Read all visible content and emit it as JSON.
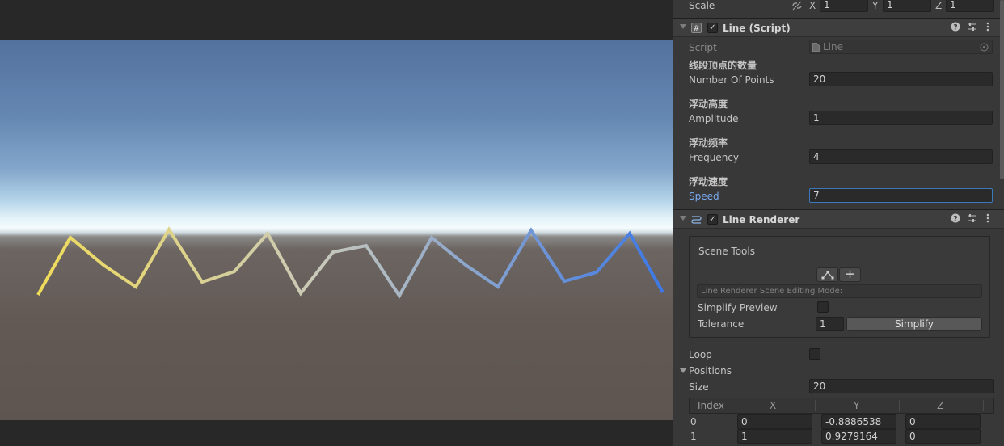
{
  "scale": {
    "label": "Scale",
    "x": "1",
    "y": "1",
    "z": "1"
  },
  "line_script": {
    "title": "Line (Script)",
    "script_label": "Script",
    "script_value": "Line",
    "num_points_header": "线段顶点的数量",
    "num_points_label": "Number Of Points",
    "num_points_value": "20",
    "amplitude_header": "浮动高度",
    "amplitude_label": "Amplitude",
    "amplitude_value": "1",
    "frequency_header": "浮动频率",
    "frequency_label": "Frequency",
    "frequency_value": "4",
    "speed_header": "浮动速度",
    "speed_label": "Speed",
    "speed_value": "7"
  },
  "line_renderer": {
    "title": "Line Renderer",
    "scene_tools_label": "Scene Tools",
    "editing_mode_placeholder": "Line Renderer Scene Editing Mode:",
    "simplify_preview_label": "Simplify Preview",
    "tolerance_label": "Tolerance",
    "tolerance_value": "1",
    "simplify_button": "Simplify",
    "loop_label": "Loop",
    "positions_label": "Positions",
    "size_label": "Size",
    "size_value": "20",
    "columns": [
      "Index",
      "X",
      "Y",
      "Z"
    ],
    "rows": [
      {
        "index": "0",
        "x": "0",
        "y": "-0.8886538",
        "z": "0"
      },
      {
        "index": "1",
        "x": "1",
        "y": "0.9279164",
        "z": "0"
      }
    ]
  },
  "axis_letters": {
    "x": "X",
    "y": "Y",
    "z": "Z"
  },
  "colors": {
    "line_start": "#f0dc5a",
    "line_end": "#3c78e6",
    "accent": "#3a79bb"
  }
}
